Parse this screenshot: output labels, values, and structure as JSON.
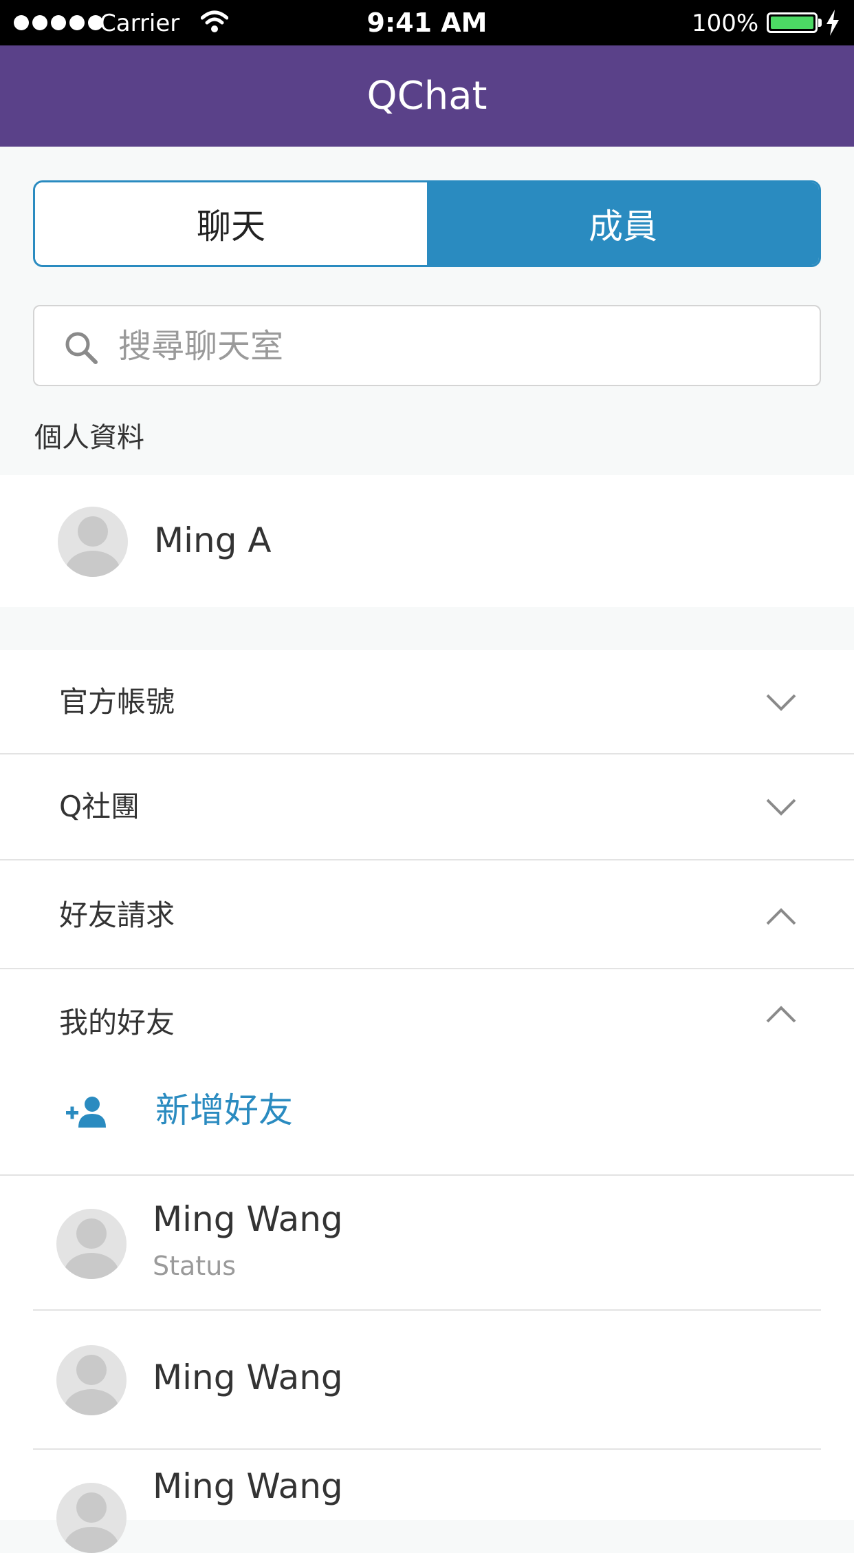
{
  "status_bar": {
    "carrier": "Carrier",
    "time": "9:41 AM",
    "battery": "100%",
    "battery_color": "#4cd964"
  },
  "nav": {
    "title": "QChat",
    "background": "#5a4189"
  },
  "segments": {
    "chat": "聊天",
    "members": "成員",
    "active": "members",
    "accent": "#2a8bc0"
  },
  "search": {
    "placeholder": "搜尋聊天室",
    "icon": "search-icon"
  },
  "profile_section": {
    "label": "個人資料",
    "name": "Ming A"
  },
  "groups": [
    {
      "label": "官方帳號",
      "expanded": false,
      "icon": "chevron-down-icon"
    },
    {
      "label": "Q社團",
      "expanded": false,
      "icon": "chevron-down-icon"
    },
    {
      "label": "好友請求",
      "expanded": true,
      "icon": "chevron-up-icon"
    },
    {
      "label": "我的好友",
      "expanded": true,
      "icon": "chevron-up-icon"
    }
  ],
  "add_friend": {
    "label": "新增好友",
    "icon": "add-person-icon"
  },
  "friends": [
    {
      "name": "Ming Wang",
      "status": "Status"
    },
    {
      "name": "Ming Wang"
    },
    {
      "name": "Ming Wang"
    }
  ]
}
